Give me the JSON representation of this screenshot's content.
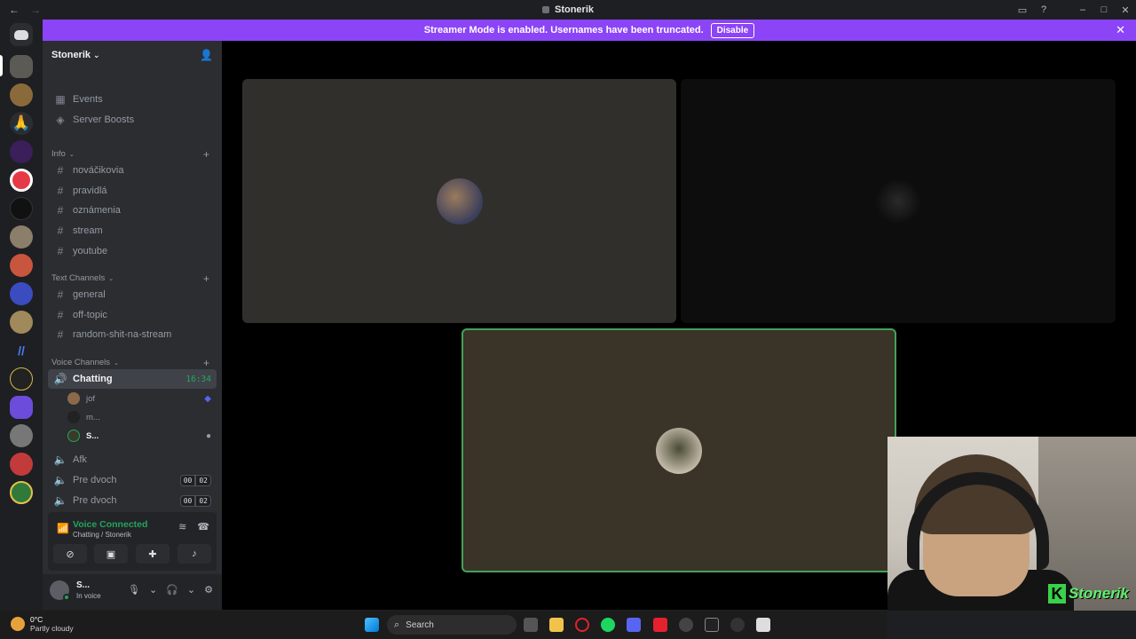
{
  "window": {
    "title": "Stonerik"
  },
  "banner": {
    "text": "Streamer Mode is enabled. Usernames have been truncated.",
    "button": "Disable"
  },
  "server": {
    "name": "Stonerik"
  },
  "sidebar": {
    "top_items": [
      {
        "label": "Events",
        "icon": "calendar-icon"
      },
      {
        "label": "Server Boosts",
        "icon": "boost-icon"
      }
    ],
    "categories": {
      "info": {
        "label": "Info",
        "channels": [
          "nováčikovia",
          "pravidlá",
          "oznámenia",
          "stream",
          "youtube"
        ]
      },
      "text": {
        "label": "Text Channels",
        "channels": [
          "general",
          "off-topic",
          "random-shit-na-stream"
        ]
      },
      "voice": {
        "label": "Voice Channels",
        "active": {
          "label": "Chatting",
          "timer": "16:34"
        },
        "members": [
          "jof",
          "m...",
          "S..."
        ],
        "others": [
          {
            "label": "Afk"
          },
          {
            "label": "Pre dvoch",
            "count_a": "00",
            "count_b": "02"
          },
          {
            "label": "Pre dvoch",
            "count_a": "00",
            "count_b": "02"
          }
        ]
      }
    }
  },
  "voice_panel": {
    "status": "Voice Connected",
    "sub": "Chatting / Stonerik"
  },
  "user_panel": {
    "name": "S...",
    "status": "In voice"
  },
  "taskbar": {
    "weather_temp": "0°C",
    "weather_desc": "Partly cloudy",
    "search": "Search"
  },
  "overlay": {
    "brand": "Stonerik",
    "letter": "K"
  },
  "colors": {
    "accent": "#8c44f7",
    "voice_green": "#23a55a",
    "tile1": "#302f2b",
    "tile2": "#0d0d0d",
    "tile3": "#3a3328"
  }
}
